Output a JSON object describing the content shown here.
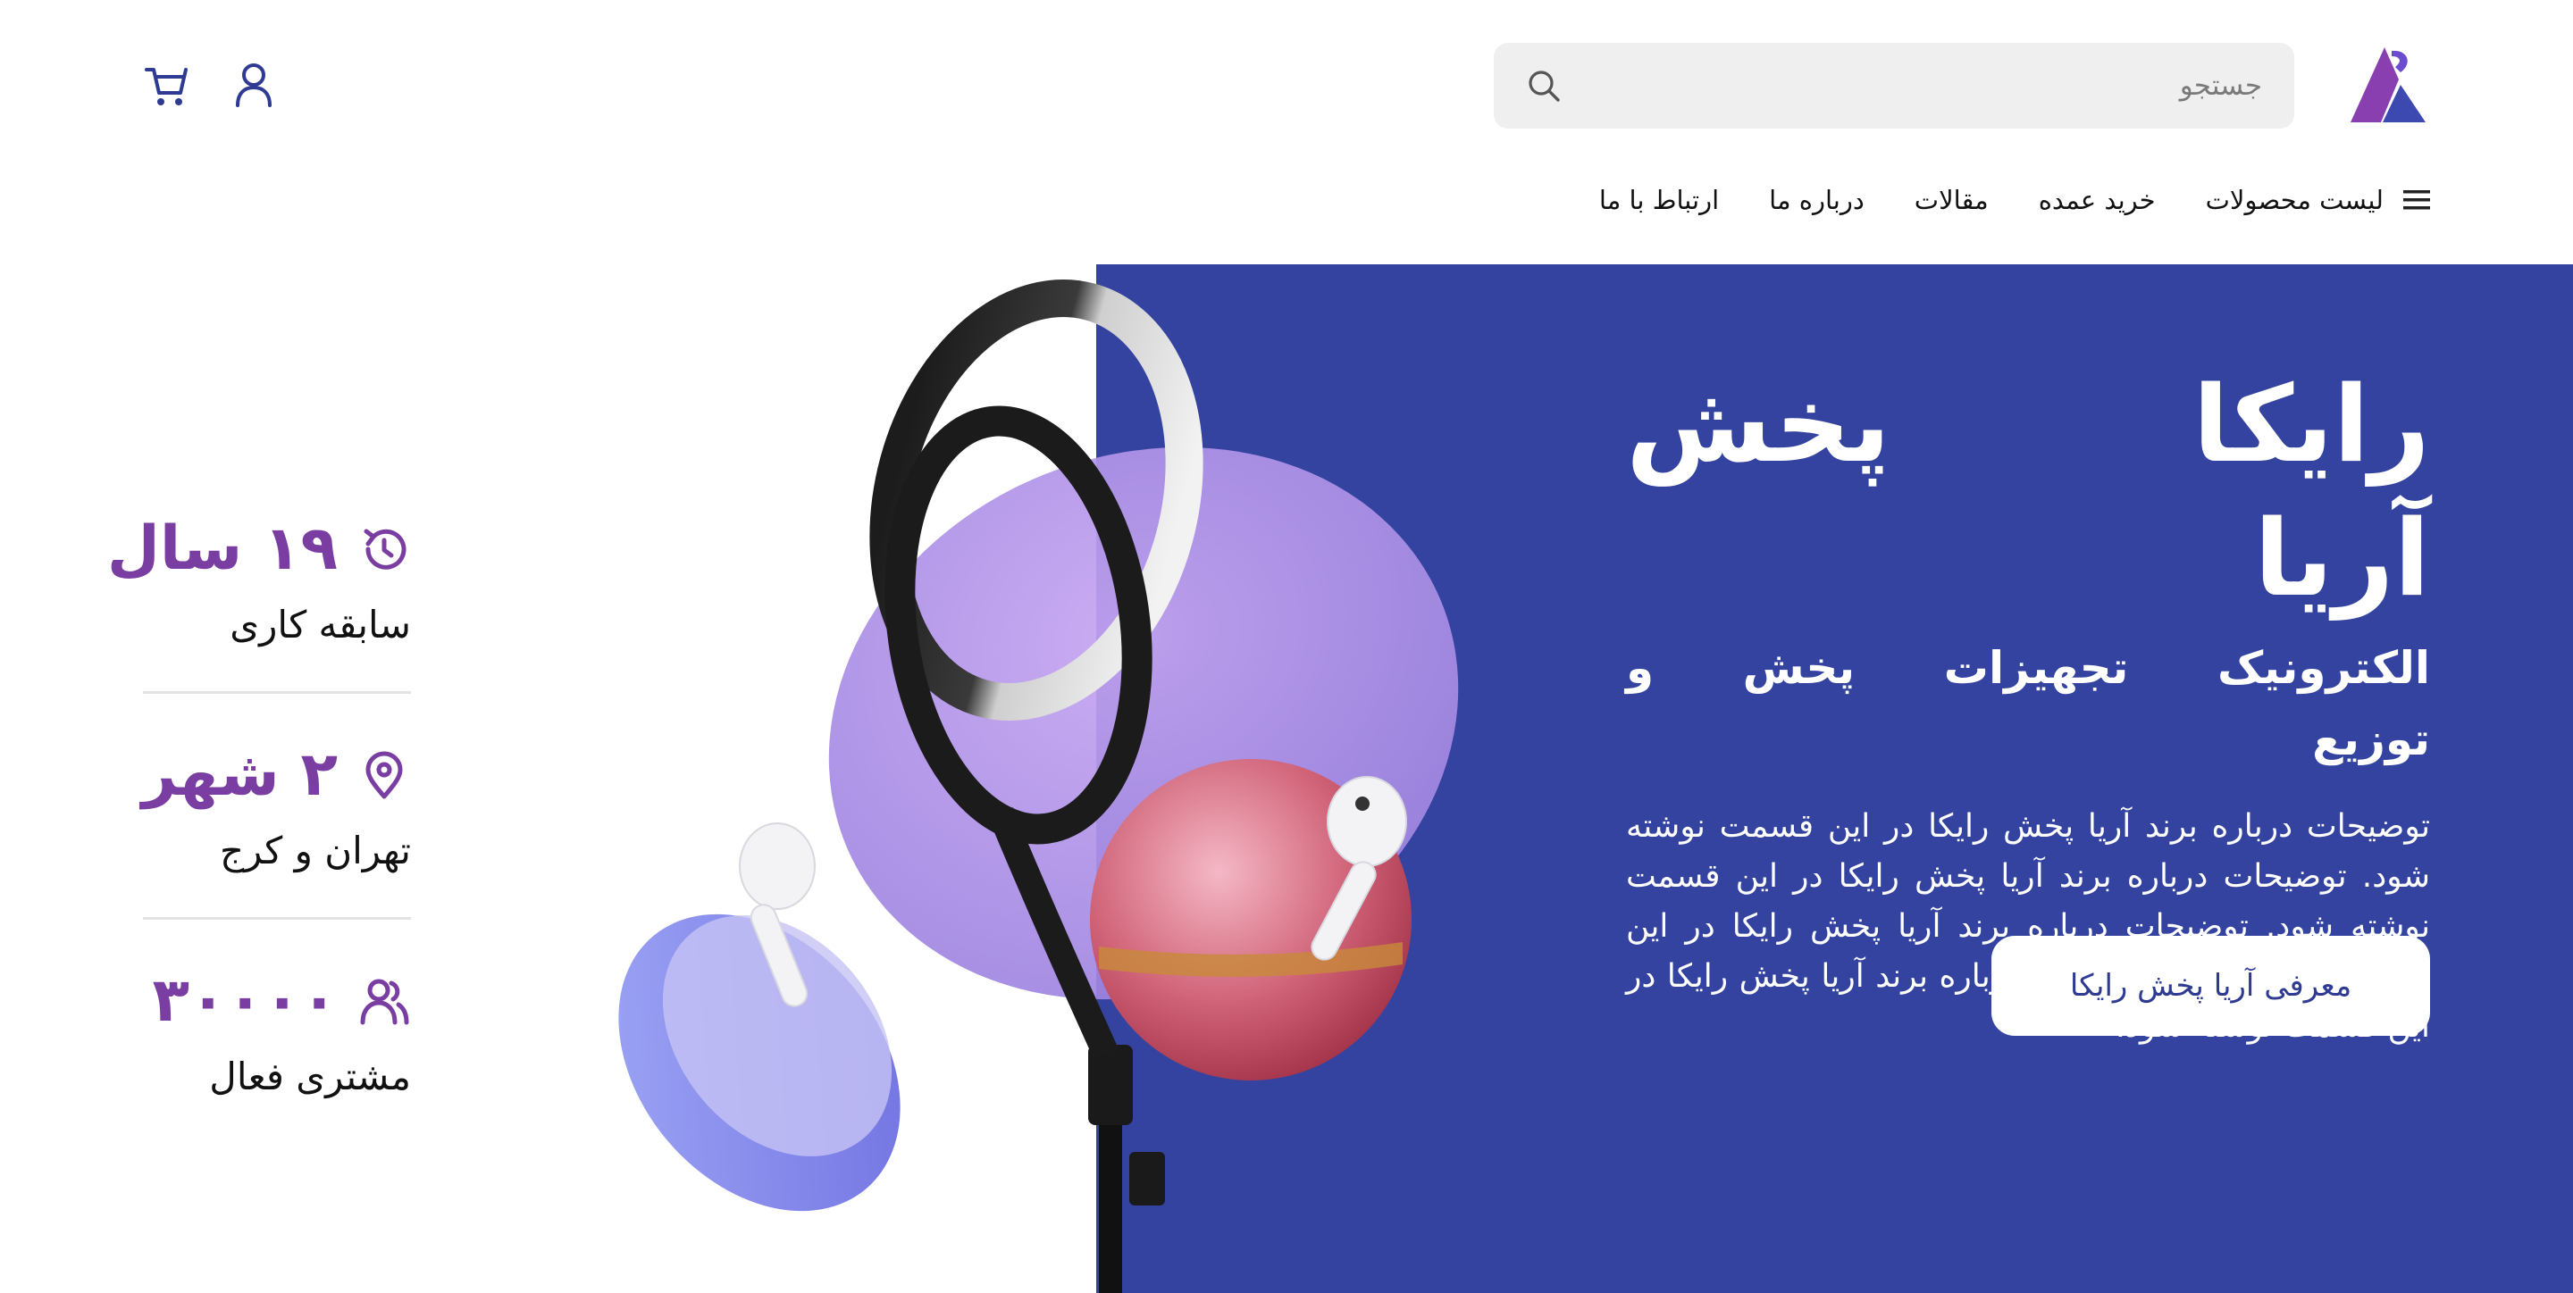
{
  "header": {
    "search": {
      "placeholder": "جستجو",
      "value": ""
    },
    "icons": {
      "logo": "brand-logo",
      "search": "search-icon",
      "user": "user-icon",
      "cart": "cart-icon"
    }
  },
  "nav": {
    "menu_icon": "hamburger-menu-icon",
    "items": [
      {
        "label": "لیست محصولات"
      },
      {
        "label": "خرید عمده"
      },
      {
        "label": "مقالات"
      },
      {
        "label": "درباره ما"
      },
      {
        "label": "ارتباط با ما"
      }
    ]
  },
  "hero": {
    "title": "رایکا پخش آریا",
    "subtitle": "الکترونیک تجهیزات پخش و توزیع",
    "description": "توضیحات درباره برند آریا پخش رایکا در این قسمت نوشته شود. توضیحات درباره برند آریا پخش رایکا در این قسمت نوشته شود. توضیحات درباره برند آریا پخش رایکا در این قسمت نوشته شود. توضیحات درباره برند آریا پخش رایکا در این قسمت نوشته شود.",
    "button_label": "معرفی آریا پخش رایکا"
  },
  "stats": [
    {
      "icon": "history-icon",
      "value": "۱۹ سال",
      "label": "سابقه کاری"
    },
    {
      "icon": "location-pin-icon",
      "value": "۲ شهر",
      "label": "تهران و کرج"
    },
    {
      "icon": "users-icon",
      "value": "۳۰۰۰۰",
      "label": "مشتری فعال"
    }
  ],
  "colors": {
    "hero_background": "#33439f",
    "accent_purple": "#7a3ea3",
    "logo_purple": "#8a3fb0",
    "logo_blue": "#3b49b0",
    "header_icon_blue": "#2f3b93",
    "search_background": "#efefef"
  }
}
